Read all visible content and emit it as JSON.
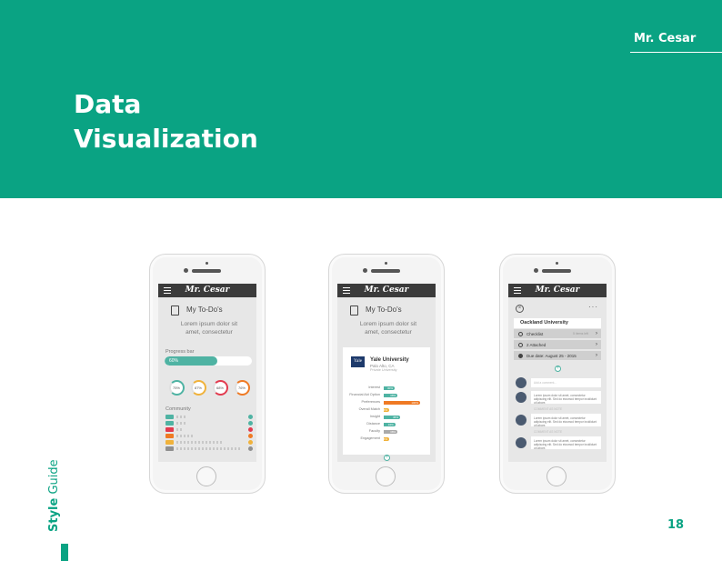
{
  "header": {
    "brand": "Mr. Cesar",
    "title_line1": "Data",
    "title_line2": "Visualization",
    "bg_color": "#0aa383"
  },
  "side_label": {
    "bold": "Style",
    "rest": "Guide"
  },
  "page_number": "18",
  "app": {
    "logo": "Mr. Cesar",
    "menu_icon": "hamburger-icon",
    "todo_title": "My To-Do's",
    "todo_sub_line1": "Lorem ipsum dolor sit",
    "todo_sub_line2": "amet, consectetur"
  },
  "phone1": {
    "progress_label": "Progress bar",
    "progress_text": "60%",
    "progress_value": 0.6,
    "progress_color": "#4fb3a3",
    "donuts": [
      {
        "label": "75%",
        "value": 75,
        "color": "#4fb3a3"
      },
      {
        "label": "87%",
        "value": 87,
        "color": "#f0b23b"
      },
      {
        "label": "68%",
        "value": 68,
        "color": "#e23b4f"
      },
      {
        "label": "76%",
        "value": 76,
        "color": "#ef7a24"
      }
    ],
    "community_label": "Community",
    "community_rows": [
      {
        "color": "#4fb3a3",
        "people": 4
      },
      {
        "color": "#4fb3a3",
        "people": 5
      },
      {
        "color": "#e23b4f",
        "people": 3
      },
      {
        "color": "#ef7a24",
        "people": 8
      },
      {
        "color": "#f0b23b",
        "people": 21
      },
      {
        "color": "#8f8f8f",
        "people": 29
      }
    ]
  },
  "phone2": {
    "school_logo": "Yale",
    "school_name": "Yale University",
    "school_location": "Palo Alto, CA",
    "school_sub": "Private University",
    "bars": [
      {
        "label": "Interest",
        "value": 30,
        "text": "30%",
        "color": "#4fb3a3"
      },
      {
        "label": "Financial Aid Option",
        "value": 38,
        "text": "38%",
        "color": "#4fb3a3"
      },
      {
        "label": "Preferences",
        "value": 100,
        "text": "100%",
        "color": "#ef7a24"
      },
      {
        "label": "Overall Match",
        "value": 15,
        "text": "15%",
        "color": "#f0b23b"
      },
      {
        "label": "Insight",
        "value": 45,
        "text": "45%",
        "color": "#4fb3a3"
      },
      {
        "label": "Distance",
        "value": 32,
        "text": "32%",
        "color": "#4fb3a3"
      },
      {
        "label": "Faculty",
        "value": 38,
        "text": "38%",
        "color": "#aaaaaa"
      },
      {
        "label": "Engagement",
        "value": 15,
        "text": "15%",
        "color": "#f0b23b"
      }
    ]
  },
  "phone3": {
    "school_name": "Oackland University",
    "rows": [
      {
        "label": "Checklist",
        "extra": "5 items left"
      },
      {
        "label": "2 Attached",
        "extra": ""
      },
      {
        "label": "Due date: August 25 - 2015",
        "extra": ""
      }
    ],
    "comment_placeholder": "Add a comment...",
    "comment_text": "Lorem ipsum dolor sit amet, consectetur adipiscing elit. Sed do eiusmod tempor incididunt ut labore.",
    "comment_link": "COMMENT AS NOTE"
  }
}
